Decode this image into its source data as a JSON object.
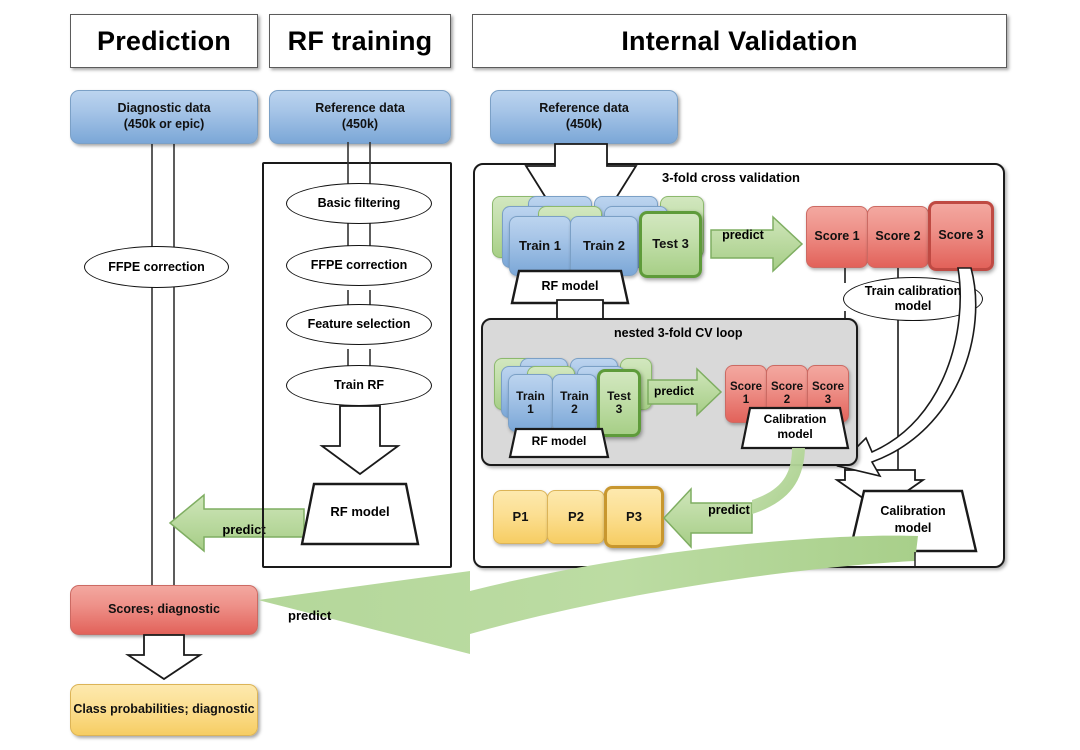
{
  "columns": [
    {
      "key": "prediction",
      "title": "Prediction"
    },
    {
      "key": "rf_training",
      "title": "RF training"
    },
    {
      "key": "internal_validation",
      "title": "Internal Validation"
    }
  ],
  "prediction": {
    "input_box": {
      "line1": "Diagnostic data",
      "line2": "(450k or epic)"
    },
    "ffpe_node": "FFPE correction",
    "predict_arrow_label": "predict",
    "scores_box": "Scores; diagnostic",
    "class_prob_box": "Class probabilities; diagnostic",
    "predict_arrow_label_2": "predict"
  },
  "rf_training": {
    "input_box": {
      "line1": "Reference data",
      "line2": "(450k)"
    },
    "steps": [
      "Basic filtering",
      "FFPE correction",
      "Feature selection",
      "Train RF"
    ],
    "model": "RF model"
  },
  "internal_validation": {
    "input_box": {
      "line1": "Reference data",
      "line2": "(450k)"
    },
    "cv_label": "3-fold cross validation",
    "outer_cv": {
      "folds": [
        {
          "label": "Train 1",
          "kind": "train"
        },
        {
          "label": "Train 2",
          "kind": "train"
        },
        {
          "label": "Test 3",
          "kind": "test"
        }
      ],
      "model": "RF model",
      "predict_arrow_label": "predict",
      "scores": [
        {
          "label": "Score 1",
          "selected": false
        },
        {
          "label": "Score 2",
          "selected": false
        },
        {
          "label": "Score 3",
          "selected": true
        }
      ],
      "train_calibration_node": {
        "line1": "Train calibration",
        "line2": "model"
      }
    },
    "nested": {
      "label": "nested 3-fold CV loop",
      "folds": [
        {
          "line1": "Train",
          "line2": "1",
          "kind": "train"
        },
        {
          "line1": "Train",
          "line2": "2",
          "kind": "train"
        },
        {
          "line1": "Test",
          "line2": "3",
          "kind": "test"
        }
      ],
      "model": "RF model",
      "predict_arrow_label": "predict",
      "scores": [
        {
          "line1": "Score",
          "line2": "1",
          "selected": false
        },
        {
          "line1": "Score",
          "line2": "2",
          "selected": false
        },
        {
          "line1": "Score",
          "line2": "3",
          "selected": false
        }
      ],
      "calibration_model": {
        "line1": "Calibration",
        "line2": "model"
      }
    },
    "probabilities": [
      {
        "label": "P1",
        "selected": false
      },
      {
        "label": "P2",
        "selected": false
      },
      {
        "label": "P3",
        "selected": true
      }
    ],
    "predict_arrow_label": "predict",
    "calibration_model": {
      "line1": "Calibration",
      "line2": "model"
    }
  },
  "colors": {
    "blue": "#a8c6e8",
    "red": "#ee9189",
    "yellow": "#fcdf92",
    "green_arrow": "#b5d79a",
    "gray_panel": "#d9d9d9",
    "outline": "#1a1a1a",
    "selected_green": "#5e9b3a",
    "selected_red": "#bf4a43",
    "selected_yellow": "#c8972f"
  }
}
